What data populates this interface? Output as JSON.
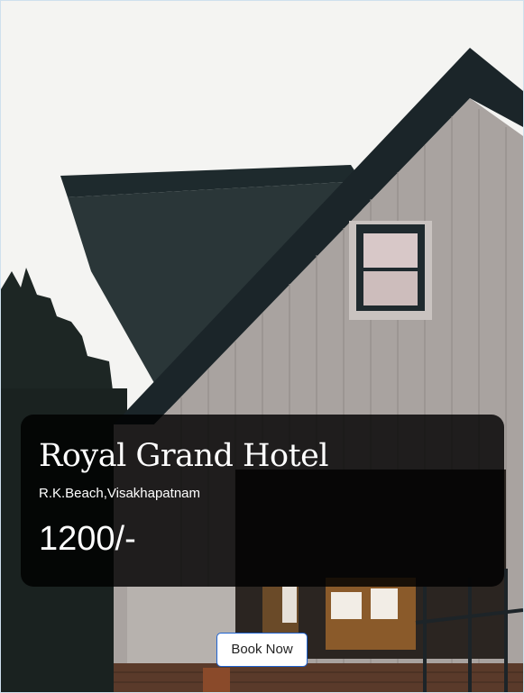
{
  "hotel": {
    "name": "Royal Grand Hotel",
    "location": "R.K.Beach,Visakhapatnam",
    "price": "1200/-"
  },
  "actions": {
    "book_label": "Book Now"
  },
  "colors": {
    "overlay": "#000000",
    "text": "#ffffff",
    "button_border": "#1f63d1"
  }
}
